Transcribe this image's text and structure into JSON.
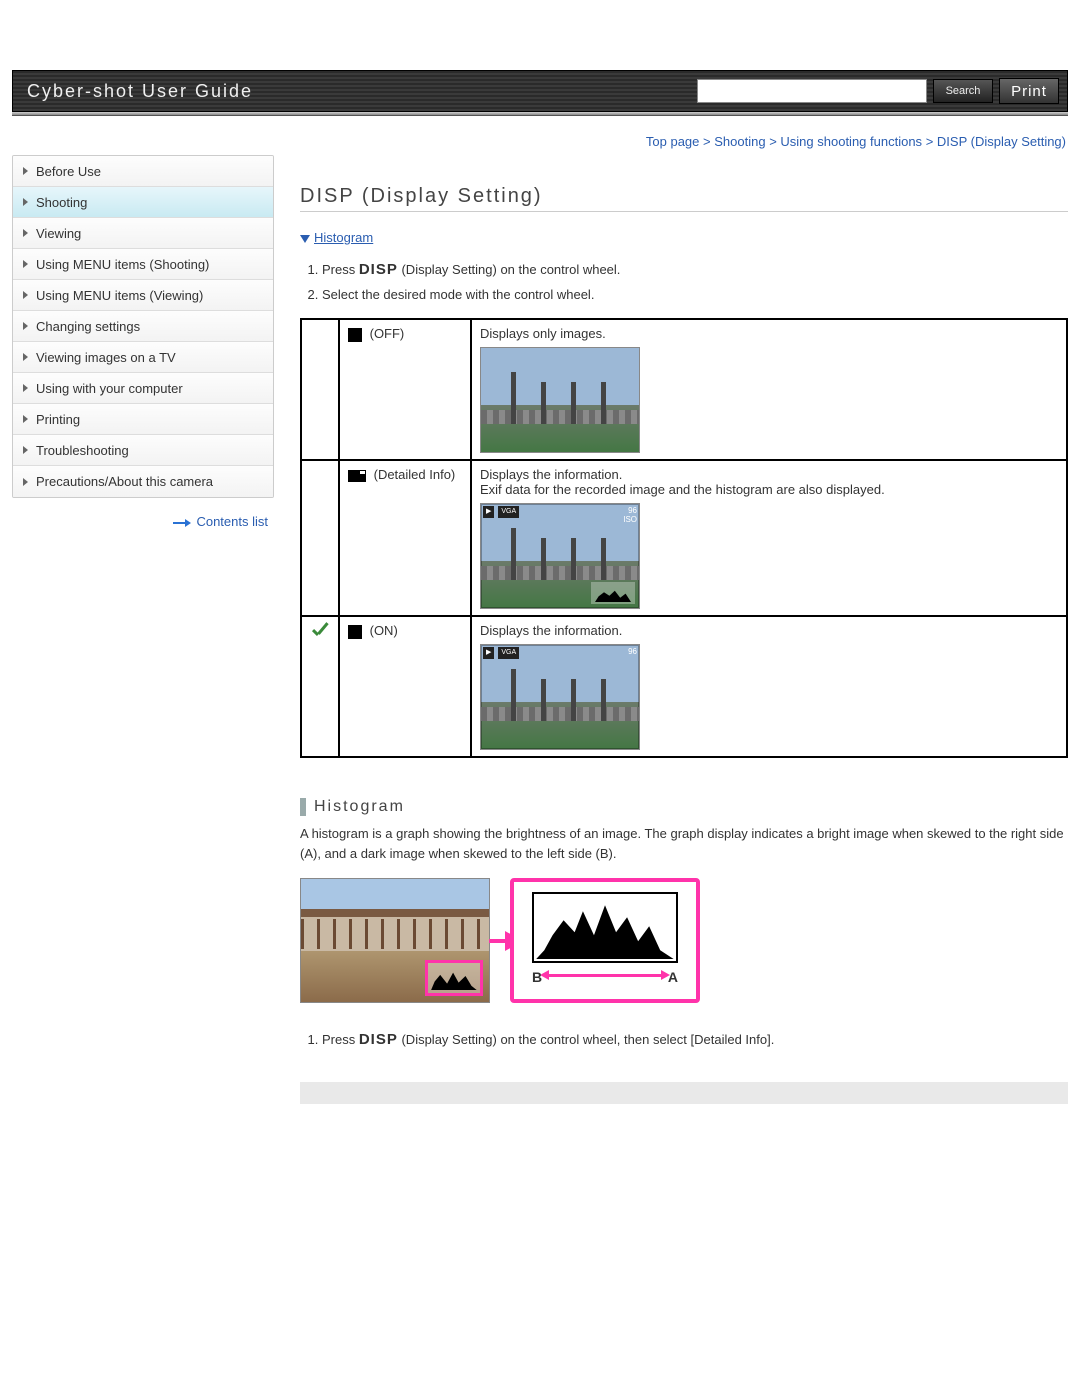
{
  "header": {
    "title": "Cyber-shot User Guide",
    "search_button": "Search",
    "print_button": "Print",
    "search_placeholder": ""
  },
  "breadcrumb": {
    "items": [
      "Top page",
      "Shooting",
      "Using shooting functions",
      "DISP (Display Setting)"
    ],
    "separator": " > "
  },
  "sidebar": {
    "items": [
      {
        "label": "Before Use",
        "active": false
      },
      {
        "label": "Shooting",
        "active": true
      },
      {
        "label": "Viewing",
        "active": false
      },
      {
        "label": "Using MENU items (Shooting)",
        "active": false
      },
      {
        "label": "Using MENU items (Viewing)",
        "active": false
      },
      {
        "label": "Changing settings",
        "active": false
      },
      {
        "label": "Viewing images on a TV",
        "active": false
      },
      {
        "label": "Using with your computer",
        "active": false
      },
      {
        "label": "Printing",
        "active": false
      },
      {
        "label": "Troubleshooting",
        "active": false
      },
      {
        "label": "Precautions/About this camera",
        "active": false
      }
    ],
    "contents_link": "Contents list"
  },
  "main": {
    "title": "DISP (Display Setting)",
    "anchor_link": "Histogram",
    "steps_primary": [
      {
        "pre": "Press ",
        "disp": "DISP",
        "post": " (Display Setting) on the control wheel."
      },
      {
        "pre": "Select the desired mode with the control wheel.",
        "disp": "",
        "post": ""
      }
    ],
    "modes": [
      {
        "checked": false,
        "name": " (OFF)",
        "icon": "off",
        "desc_lines": [
          "Displays only images."
        ]
      },
      {
        "checked": false,
        "name": " (Detailed Info)",
        "icon": "info",
        "desc_lines": [
          "Displays the information.",
          "Exif data for the recorded image and the histogram are also displayed."
        ]
      },
      {
        "checked": true,
        "name": " (ON)",
        "icon": "on",
        "desc_lines": [
          "Displays the information."
        ]
      }
    ],
    "histogram": {
      "heading": "Histogram",
      "body": "A histogram is a graph showing the brightness of an image. The graph display indicates a bright image when skewed to the right side (A), and a dark image when skewed to the left side (B).",
      "axis_left": "B",
      "axis_right": "A",
      "step": {
        "pre": "Press ",
        "disp": "DISP",
        "post": " (Display Setting) on the control wheel, then select [Detailed Info]."
      }
    }
  }
}
